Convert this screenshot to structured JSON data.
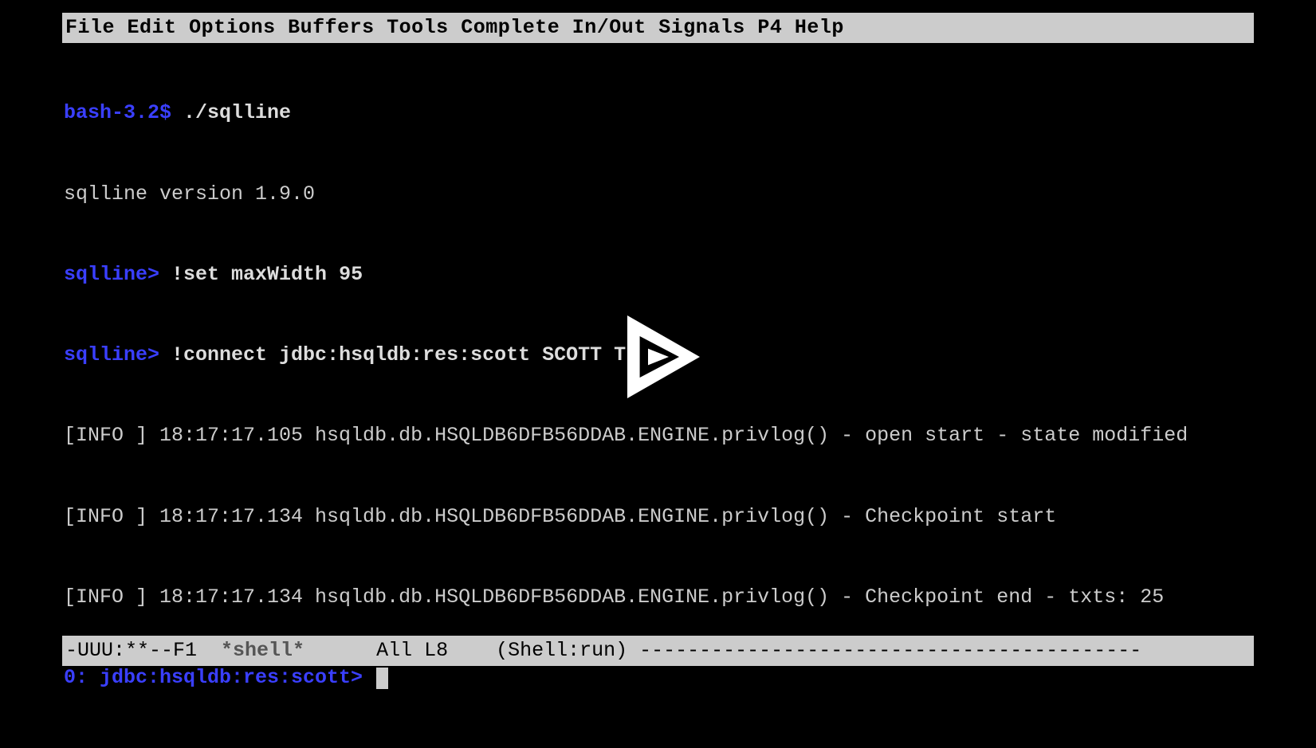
{
  "menubar": {
    "items": [
      "File",
      "Edit",
      "Options",
      "Buffers",
      "Tools",
      "Complete",
      "In/Out",
      "Signals",
      "P4",
      "Help"
    ]
  },
  "terminal": {
    "lines": [
      {
        "prompt": "bash-3.2$ ",
        "command": "./sqlline"
      },
      {
        "output": "sqlline version 1.9.0"
      },
      {
        "prompt": "sqlline> ",
        "command": "!set maxWidth 95"
      },
      {
        "prompt": "sqlline> ",
        "command": "!connect jdbc:hsqldb:res:scott SCOTT TIGER"
      },
      {
        "output": "[INFO ] 18:17:17.105 hsqldb.db.HSQLDB6DFB56DDAB.ENGINE.privlog() - open start - state modified"
      },
      {
        "output": "[INFO ] 18:17:17.134 hsqldb.db.HSQLDB6DFB56DDAB.ENGINE.privlog() - Checkpoint start"
      },
      {
        "output": "[INFO ] 18:17:17.134 hsqldb.db.HSQLDB6DFB56DDAB.ENGINE.privlog() - Checkpoint end - txts: 25"
      },
      {
        "prompt": "0: jdbc:hsqldb:res:scott> ",
        "cursor": true
      }
    ]
  },
  "modeline": {
    "status": "-UUU:**--F1  ",
    "buffer": "*shell*",
    "position": "      All L8    ",
    "mode": "(Shell:run) ",
    "dashes": "------------------------------------------"
  },
  "overlay": {
    "play_label": "play"
  }
}
